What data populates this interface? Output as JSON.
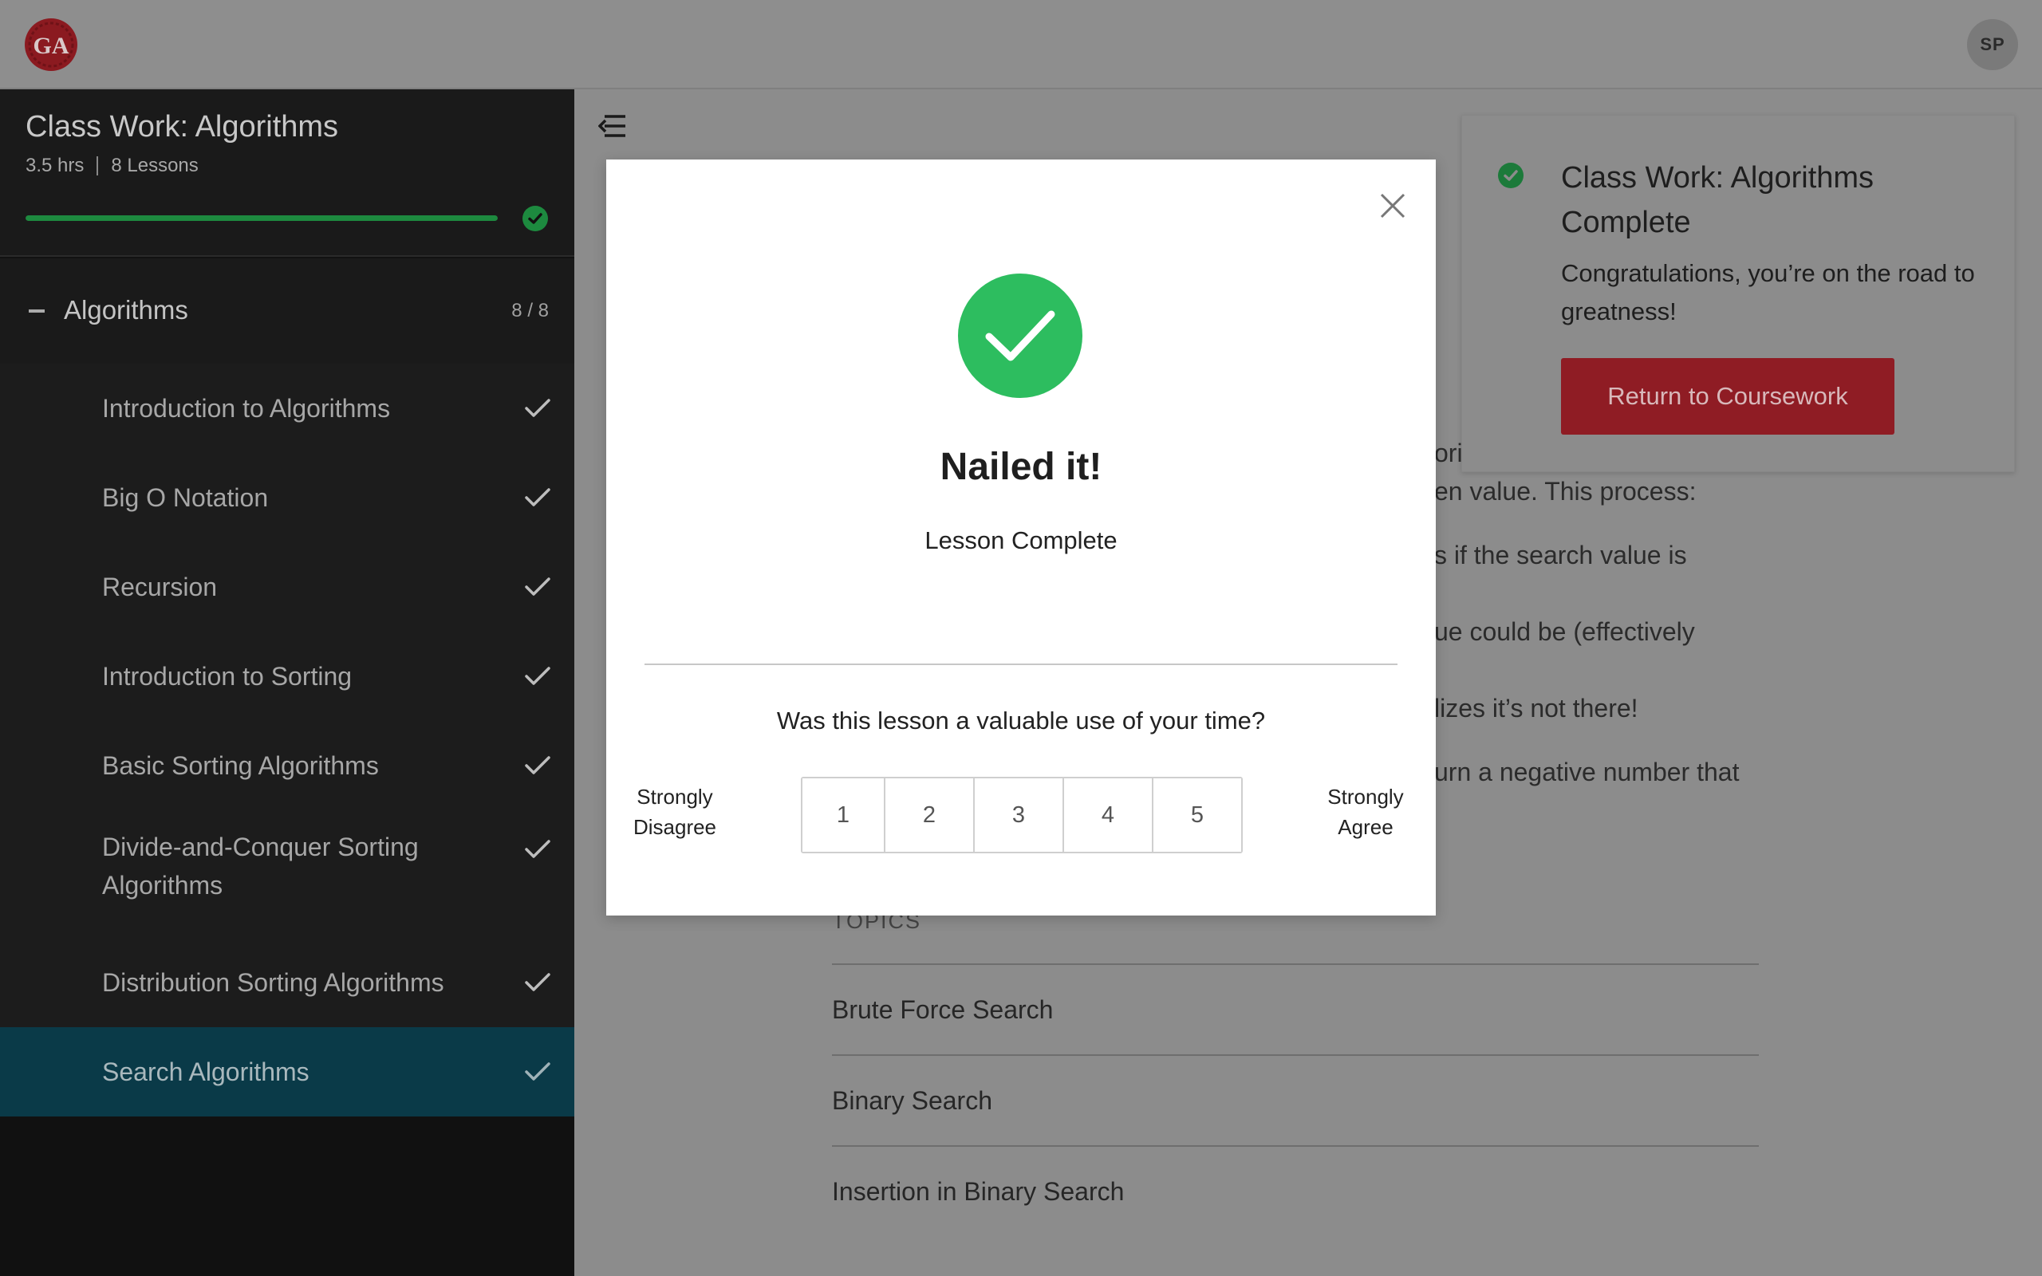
{
  "header": {
    "logo_text": "GA",
    "avatar_initials": "SP"
  },
  "sidebar": {
    "course_title": "Class Work: Algorithms",
    "duration": "3.5 hrs",
    "lesson_count": "8 Lessons",
    "progress_percent": 100,
    "section": {
      "title": "Algorithms",
      "count": "8 / 8"
    },
    "lessons": [
      {
        "label": "Introduction to Algorithms",
        "completed": true,
        "active": false
      },
      {
        "label": "Big O Notation",
        "completed": true,
        "active": false
      },
      {
        "label": "Recursion",
        "completed": true,
        "active": false
      },
      {
        "label": "Introduction to Sorting",
        "completed": true,
        "active": false
      },
      {
        "label": "Basic Sorting Algorithms",
        "completed": true,
        "active": false
      },
      {
        "label": "Divide-and-Conquer Sorting Algorithms",
        "completed": true,
        "active": false
      },
      {
        "label": "Distribution Sorting Algorithms",
        "completed": true,
        "active": false
      },
      {
        "label": "Search Algorithms",
        "completed": true,
        "active": true
      }
    ]
  },
  "content": {
    "fragments": [
      "ori",
      "en value. This process:",
      "s if the search value is",
      "ue could be (effectively",
      "lizes it’s not there!",
      "urn a negative number that"
    ],
    "topics_label": "TOPICS",
    "topics": [
      "Brute Force Search",
      "Binary Search",
      "Insertion in Binary Search"
    ]
  },
  "completion_card": {
    "title": "Class Work: Algorithms Complete",
    "body": "Congratulations, you’re on the road to greatness!",
    "button_label": "Return to Coursework"
  },
  "modal": {
    "title": "Nailed it!",
    "subtitle": "Lesson Complete",
    "question": "Was this lesson a valuable use of your time?",
    "scale_low": "Strongly Disagree",
    "scale_high": "Strongly Agree",
    "ratings": [
      "1",
      "2",
      "3",
      "4",
      "5"
    ]
  },
  "colors": {
    "success_green": "#2dbd5f",
    "brand_red": "#b4202b",
    "active_lesson": "#0a3a48"
  }
}
